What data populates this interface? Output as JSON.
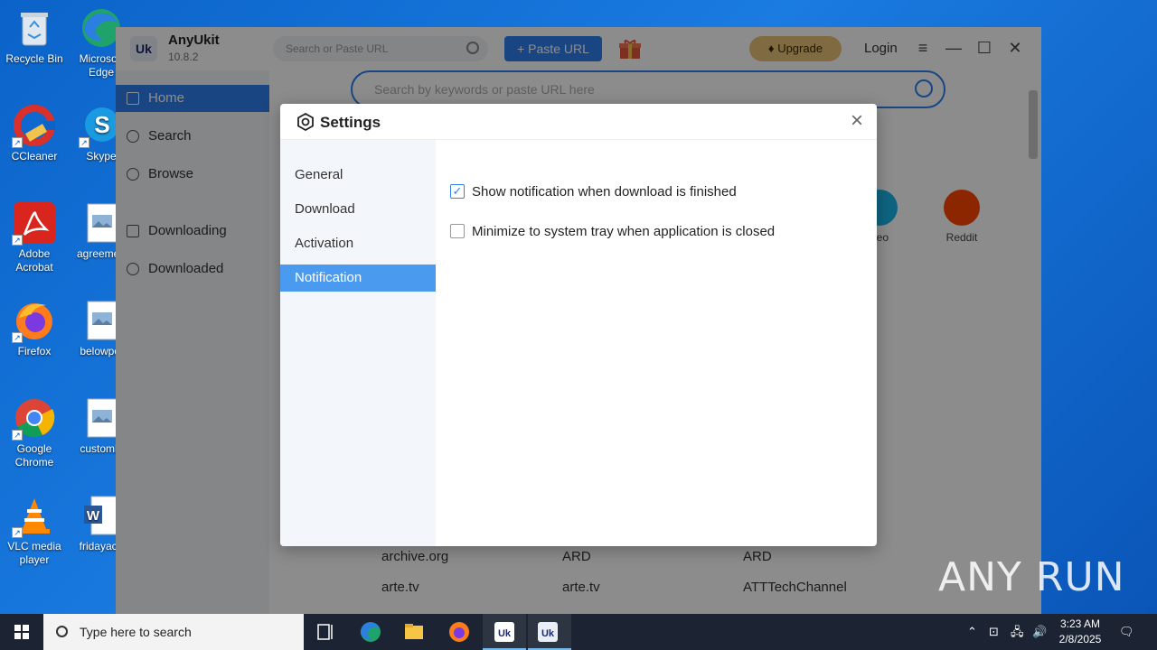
{
  "desktop": {
    "icons": [
      {
        "label": "Recycle Bin",
        "icon": "recycle-bin-icon"
      },
      {
        "label": "Microsoft Edge",
        "icon": "edge-icon"
      },
      {
        "label": "CCleaner",
        "icon": "ccleaner-icon"
      },
      {
        "label": "Skype",
        "icon": "skype-icon"
      },
      {
        "label": "Adobe Acrobat",
        "icon": "acrobat-icon"
      },
      {
        "label": "agreemen",
        "icon": "image-file-icon"
      },
      {
        "label": "Firefox",
        "icon": "firefox-icon"
      },
      {
        "label": "belowpol",
        "icon": "image-file-icon"
      },
      {
        "label": "Google Chrome",
        "icon": "chrome-icon"
      },
      {
        "label": "customlif",
        "icon": "image-file-icon"
      },
      {
        "label": "VLC media player",
        "icon": "vlc-icon"
      },
      {
        "label": "fridayaca",
        "icon": "word-file-icon"
      }
    ]
  },
  "app": {
    "name": "AnyUkit",
    "version": "10.8.2",
    "logo_text": "Uk",
    "top_search_placeholder": "Search or Paste URL",
    "paste_url_label": "+ Paste URL",
    "upgrade_label": "Upgrade",
    "login_label": "Login",
    "sidebar": [
      {
        "label": "Home",
        "active": true
      },
      {
        "label": "Search",
        "active": false
      },
      {
        "label": "Browse",
        "active": false
      },
      {
        "label": "Downloading",
        "active": false
      },
      {
        "label": "Downloaded",
        "active": false
      }
    ],
    "main_search_placeholder": "Search by keywords or paste URL here",
    "site_icons": [
      {
        "label": "neo",
        "color": "#1ab7ea"
      },
      {
        "label": "Reddit",
        "color": "#ff4500"
      }
    ],
    "site_rows": [
      [
        "archive.org",
        "ARD",
        "ARD"
      ],
      [
        "arte.tv",
        "arte.tv",
        "ATTTechChannel"
      ]
    ]
  },
  "settings": {
    "title": "Settings",
    "tabs": [
      {
        "label": "General",
        "active": false
      },
      {
        "label": "Download",
        "active": false
      },
      {
        "label": "Activation",
        "active": false
      },
      {
        "label": "Notification",
        "active": true
      }
    ],
    "options": [
      {
        "label": "Show notification when download is finished",
        "checked": true
      },
      {
        "label": "Minimize to system tray when application is closed",
        "checked": false
      }
    ]
  },
  "watermark": "ANY RUN",
  "taskbar": {
    "search_placeholder": "Type here to search",
    "time": "3:23 AM",
    "date": "2/8/2025"
  },
  "colors": {
    "accent": "#2f80ed",
    "active_tab": "#4a9bf0",
    "upgrade": "#e9c277",
    "taskbar": "#1c2434"
  }
}
